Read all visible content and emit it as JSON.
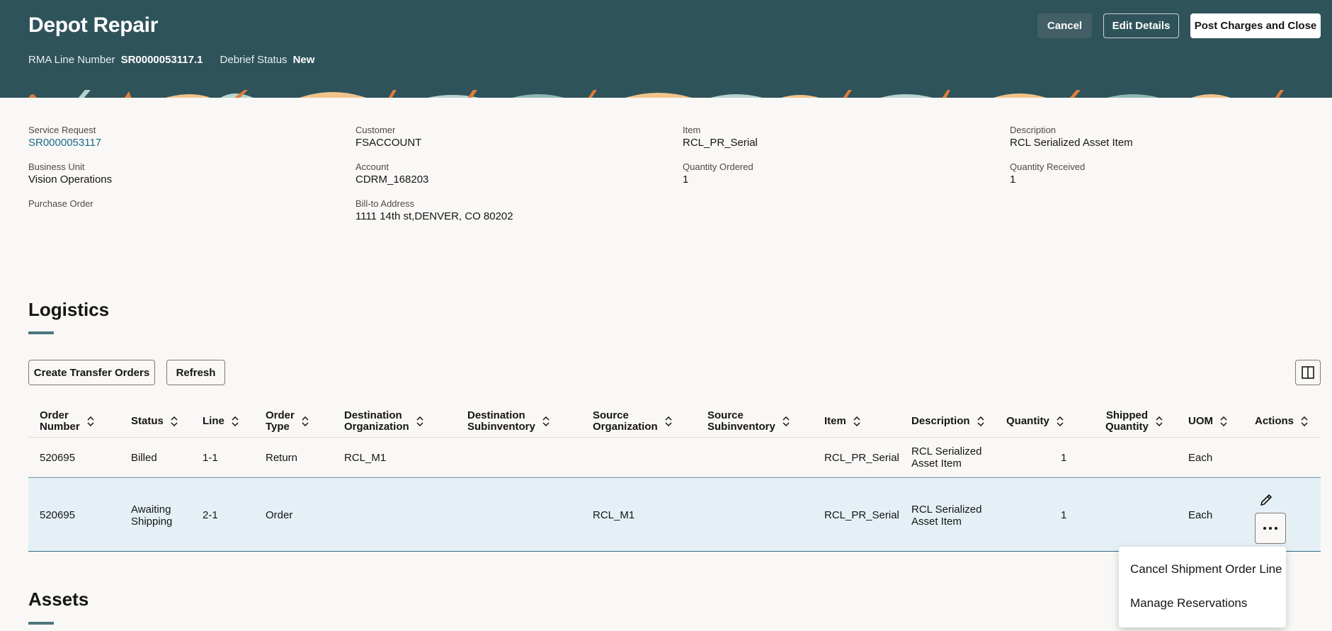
{
  "header": {
    "title": "Depot Repair",
    "rma_label": "RMA Line Number",
    "rma_value": "SR0000053117.1",
    "debrief_label": "Debrief Status",
    "debrief_value": "New",
    "cancel_label": "Cancel",
    "edit_label": "Edit Details",
    "post_label": "Post Charges and Close"
  },
  "details": {
    "service_request": {
      "label": "Service Request",
      "value": "SR0000053117"
    },
    "business_unit": {
      "label": "Business Unit",
      "value": "Vision Operations"
    },
    "purchase_order": {
      "label": "Purchase Order",
      "value": ""
    },
    "customer": {
      "label": "Customer",
      "value": "FSACCOUNT"
    },
    "account": {
      "label": "Account",
      "value": "CDRM_168203"
    },
    "bill_to": {
      "label": "Bill-to Address",
      "value": "1111 14th st,DENVER, CO 80202"
    },
    "item": {
      "label": "Item",
      "value": "RCL_PR_Serial"
    },
    "qty_ordered": {
      "label": "Quantity Ordered",
      "value": "1"
    },
    "description": {
      "label": "Description",
      "value": "RCL Serialized Asset Item"
    },
    "qty_received": {
      "label": "Quantity Received",
      "value": "1"
    }
  },
  "logistics": {
    "title": "Logistics",
    "create_label": "Create Transfer Orders",
    "refresh_label": "Refresh",
    "columns": [
      [
        "Order",
        "Number"
      ],
      [
        "Status"
      ],
      [
        "Line"
      ],
      [
        "Order",
        "Type"
      ],
      [
        "Destination",
        "Organization"
      ],
      [
        "Destination",
        "Subinventory"
      ],
      [
        "Source",
        "Organization"
      ],
      [
        "Source",
        "Subinventory"
      ],
      [
        "Item"
      ],
      [
        "Description"
      ],
      [
        "Quantity"
      ],
      [
        "Shipped",
        "Quantity"
      ],
      [
        "UOM"
      ],
      [
        "Actions"
      ]
    ],
    "rows": [
      {
        "order": "520695",
        "status": "Billed",
        "line": "1-1",
        "type": "Return",
        "dest_org": "RCL_M1",
        "dest_sub": "",
        "src_org": "",
        "src_sub": "",
        "item": "RCL_PR_Serial",
        "desc1": "RCL Serialized",
        "desc2": "Asset Item",
        "qty": "1",
        "shipped": "",
        "uom": "Each"
      },
      {
        "order": "520695",
        "status1": "Awaiting",
        "status2": "Shipping",
        "line": "2-1",
        "type": "Order",
        "dest_org": "",
        "dest_sub": "",
        "src_org": "RCL_M1",
        "src_sub": "",
        "item": "RCL_PR_Serial",
        "desc1": "RCL Serialized",
        "desc2": "Asset Item",
        "qty": "1",
        "shipped": "",
        "uom": "Each"
      }
    ]
  },
  "menu": {
    "item1": "Cancel Shipment Order Line",
    "item2": "Manage Reservations"
  },
  "assets": {
    "title": "Assets"
  },
  "colors": {
    "header": "#2f535a",
    "selected_row": "#e4f0f5",
    "link": "#1b6a87"
  }
}
